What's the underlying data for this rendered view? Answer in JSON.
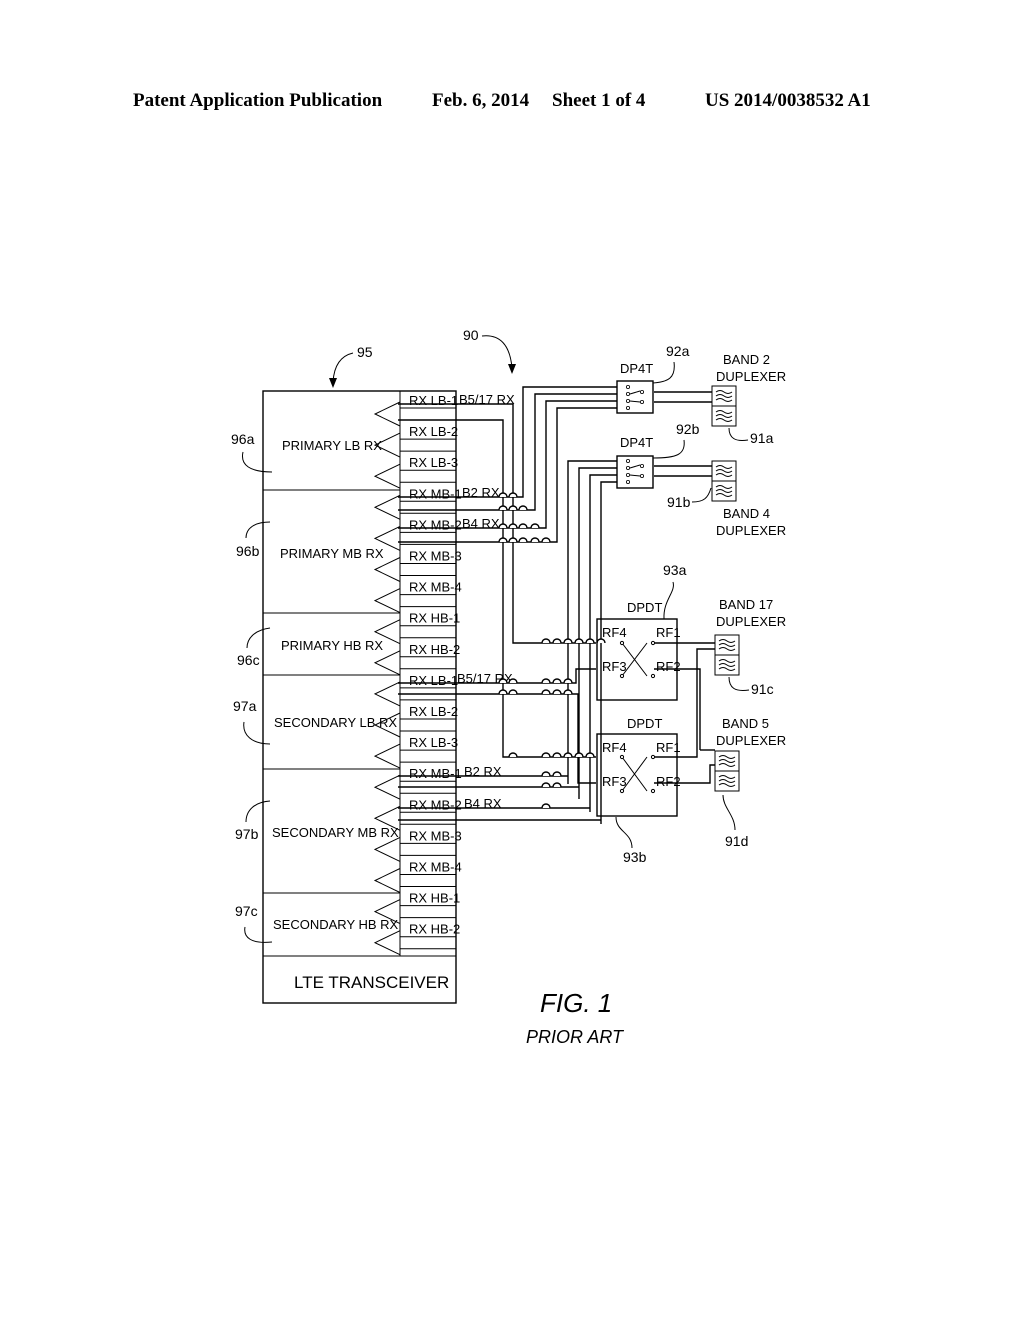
{
  "header": {
    "publication": "Patent Application Publication",
    "date": "Feb. 6, 2014",
    "sheet": "Sheet 1 of 4",
    "number": "US 2014/0038532 A1"
  },
  "figure": {
    "title": "FIG. 1",
    "subtitle": "PRIOR ART",
    "refs": {
      "system": "90",
      "transceiver": "95",
      "dp4t_a": "92a",
      "dp4t_b": "92b",
      "dpdt_a": "93a",
      "dpdt_b": "93b",
      "dup_a": "91a",
      "dup_b": "91b",
      "dup_c": "91c",
      "dup_d": "91d",
      "primary_lb": "96a",
      "primary_mb": "96b",
      "primary_hb": "96c",
      "secondary_lb": "97a",
      "secondary_mb": "97b",
      "secondary_hb": "97c"
    },
    "transceiver": {
      "title": "LTE TRANSCEIVER",
      "blocks": [
        {
          "name": "PRIMARY LB RX",
          "ports": [
            "RX LB-1",
            "RX LB-2",
            "RX LB-3"
          ]
        },
        {
          "name": "PRIMARY MB RX",
          "ports": [
            "RX MB-1",
            "RX MB-2",
            "RX MB-3",
            "RX MB-4"
          ]
        },
        {
          "name": "PRIMARY HB RX",
          "ports": [
            "RX HB-1",
            "RX HB-2"
          ]
        },
        {
          "name": "SECONDARY LB RX",
          "ports": [
            "RX LB-1",
            "RX LB-2",
            "RX LB-3"
          ]
        },
        {
          "name": "SECONDARY MB RX",
          "ports": [
            "RX MB-1",
            "RX MB-2",
            "RX MB-3",
            "RX MB-4"
          ]
        },
        {
          "name": "SECONDARY HB RX",
          "ports": [
            "RX HB-1",
            "RX HB-2"
          ]
        }
      ]
    },
    "signals": {
      "b5_17_primary": "B5/17 RX",
      "b2_primary": "B2 RX",
      "b4_primary": "B4 RX",
      "b5_17_secondary": "B5/17 RX",
      "b2_secondary": "B2 RX",
      "b4_secondary": "B4 RX"
    },
    "switches": {
      "dp4t_a": "DP4T",
      "dp4t_b": "DP4T",
      "dpdt_a": {
        "title": "DPDT",
        "ports": [
          "RF4",
          "RF1",
          "RF3",
          "RF2"
        ]
      },
      "dpdt_b": {
        "title": "DPDT",
        "ports": [
          "RF4",
          "RF1",
          "RF3",
          "RF2"
        ]
      }
    },
    "duplexers": {
      "band2": [
        "BAND 2",
        "DUPLEXER"
      ],
      "band4": [
        "BAND 4",
        "DUPLEXER"
      ],
      "band17": [
        "BAND 17",
        "DUPLEXER"
      ],
      "band5": [
        "BAND 5",
        "DUPLEXER"
      ]
    }
  }
}
